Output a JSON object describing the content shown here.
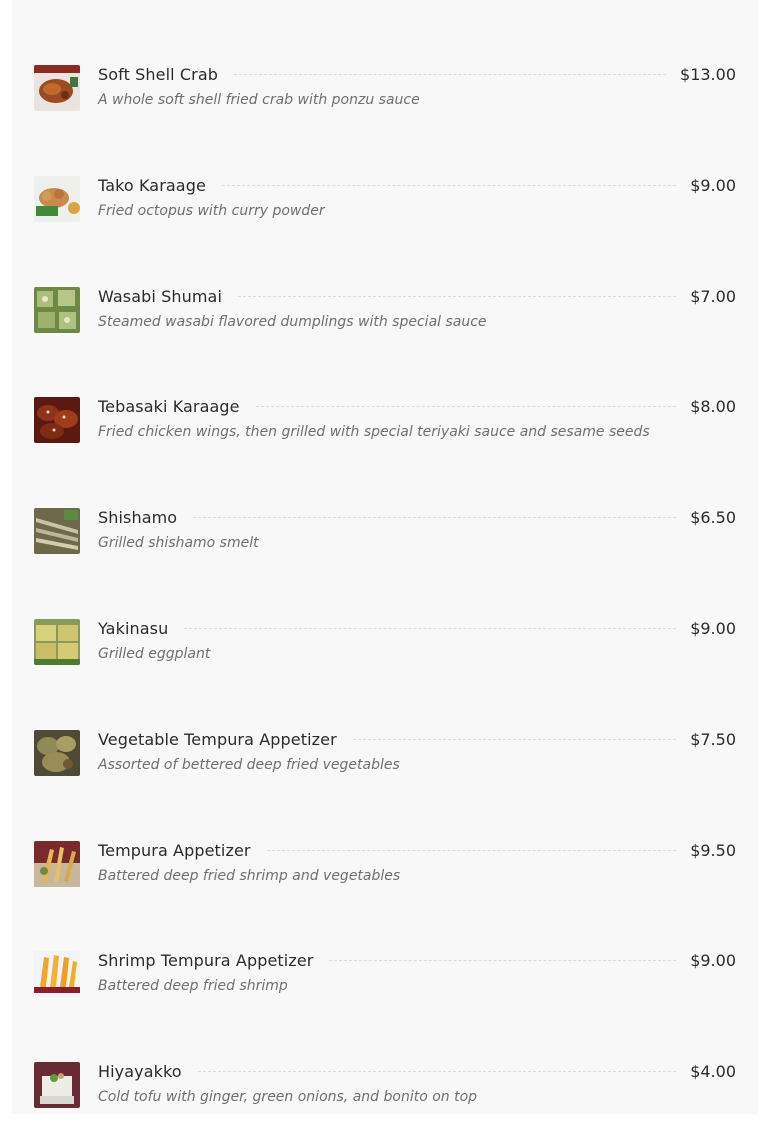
{
  "menu": {
    "items": [
      {
        "name": "Soft Shell Crab",
        "price": "$13.00",
        "description": "A whole soft shell fried crab with ponzu sauce",
        "image": "soft-shell-crab-photo"
      },
      {
        "name": "Tako Karaage",
        "price": "$9.00",
        "description": "Fried octopus with curry powder",
        "image": "tako-karaage-photo"
      },
      {
        "name": "Wasabi Shumai",
        "price": "$7.00",
        "description": "Steamed wasabi flavored dumplings with special sauce",
        "image": "wasabi-shumai-photo"
      },
      {
        "name": "Tebasaki Karaage",
        "price": "$8.00",
        "description": "Fried chicken wings, then grilled with special teriyaki sauce and sesame seeds",
        "image": "tebasaki-karaage-photo"
      },
      {
        "name": "Shishamo",
        "price": "$6.50",
        "description": "Grilled shishamo smelt",
        "image": "shishamo-photo"
      },
      {
        "name": "Yakinasu",
        "price": "$9.00",
        "description": "Grilled eggplant",
        "image": "yakinasu-photo"
      },
      {
        "name": "Vegetable Tempura Appetizer",
        "price": "$7.50",
        "description": "Assorted of bettered deep fried vegetables",
        "image": "vegetable-tempura-photo"
      },
      {
        "name": "Tempura Appetizer",
        "price": "$9.50",
        "description": "Battered deep fried shrimp and vegetables",
        "image": "tempura-appetizer-photo"
      },
      {
        "name": "Shrimp Tempura Appetizer",
        "price": "$9.00",
        "description": "Battered deep fried shrimp",
        "image": "shrimp-tempura-photo"
      },
      {
        "name": "Hiyayakko",
        "price": "$4.00",
        "description": "Cold tofu with ginger, green onions, and bonito on top",
        "image": "hiyayakko-photo"
      }
    ]
  },
  "colors": {
    "page_background": "#f8f8f9",
    "text_primary": "#2b2b2b",
    "text_secondary": "#6f6f6f",
    "leader_line": "#dadada"
  }
}
